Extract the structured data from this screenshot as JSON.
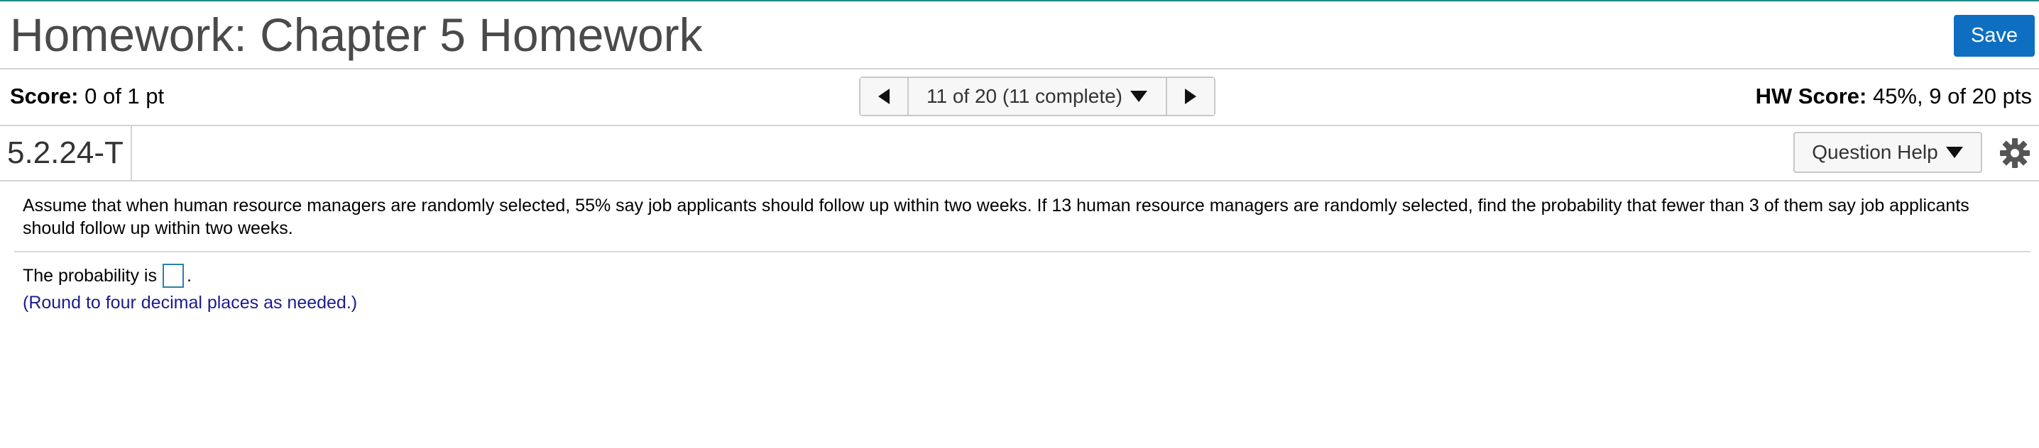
{
  "header": {
    "title": "Homework: Chapter 5 Homework",
    "save_label": "Save"
  },
  "score": {
    "label": "Score:",
    "value": "0 of 1 pt"
  },
  "navigation": {
    "position_text": "11 of 20 (11 complete)",
    "prev_icon": "triangle-left",
    "next_icon": "triangle-right",
    "dropdown_icon": "triangle-down"
  },
  "hw_score": {
    "label": "HW Score:",
    "value": "45%, 9 of 20 pts"
  },
  "question_bar": {
    "id": "5.2.24-T",
    "help_label": "Question Help",
    "settings_icon": "gear"
  },
  "question": {
    "text": "Assume that when human resource managers are randomly selected, 55% say job applicants should follow up within two weeks. If 13 human resource managers are randomly selected, find the probability that fewer than 3 of them say job applicants should follow up within two weeks.",
    "answer_prefix": "The probability is",
    "answer_suffix": ".",
    "answer_value": "",
    "hint": "(Round to four decimal places as needed.)"
  },
  "colors": {
    "accent": "#0e6fc2",
    "top_rule": "#1e8a8a",
    "hint_text": "#1c1c8c",
    "title_text": "#4a4a4a"
  }
}
